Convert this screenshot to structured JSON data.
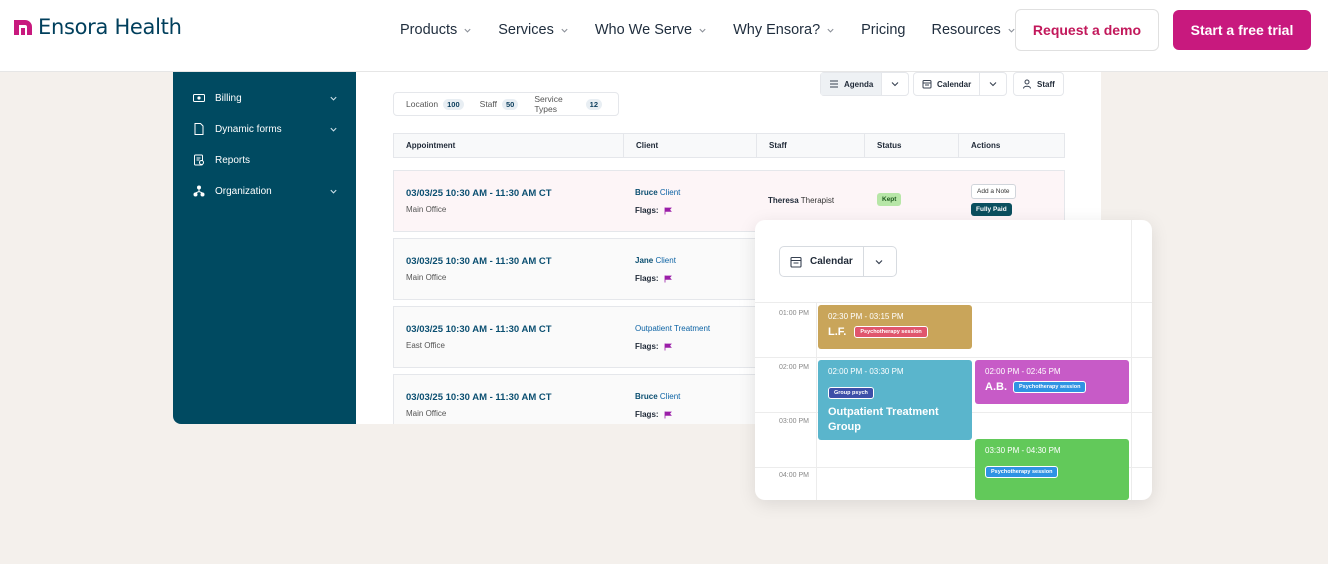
{
  "brand": {
    "name": "Ensora Health",
    "color": "#c8197e",
    "dark": "#003f5c"
  },
  "nav": {
    "items": [
      {
        "label": "Products",
        "dropdown": true
      },
      {
        "label": "Services",
        "dropdown": true
      },
      {
        "label": "Who We Serve",
        "dropdown": true
      },
      {
        "label": "Why Ensora?",
        "dropdown": true
      },
      {
        "label": "Pricing",
        "dropdown": false
      },
      {
        "label": "Resources",
        "dropdown": true
      }
    ],
    "demo_label": "Request a demo",
    "trial_label": "Start a free trial"
  },
  "sidebar": {
    "items": [
      {
        "label": "Billing",
        "icon": "billing-icon",
        "expandable": true
      },
      {
        "label": "Dynamic forms",
        "icon": "document-icon",
        "expandable": true
      },
      {
        "label": "Reports",
        "icon": "reports-icon",
        "expandable": false
      },
      {
        "label": "Organization",
        "icon": "organization-icon",
        "expandable": true
      }
    ]
  },
  "filters": [
    {
      "label": "Location",
      "count": "100"
    },
    {
      "label": "Staff",
      "count": "50"
    },
    {
      "label": "Service Types",
      "count": "12"
    }
  ],
  "views": {
    "agenda": "Agenda",
    "calendar": "Calendar",
    "staff": "Staff"
  },
  "table": {
    "headers": [
      "Appointment",
      "Client",
      "Staff",
      "Status",
      "Actions"
    ],
    "rows": [
      {
        "time": "03/03/25 10:30 AM - 11:30 AM CT",
        "location": "Main Office",
        "client_first": "Bruce",
        "client_rest": "Client",
        "flags": "Flags:",
        "staff_first": "Theresa",
        "staff_rest": "Therapist",
        "status": "Kept",
        "action1": "Add a Note",
        "action2": "Fully Paid"
      },
      {
        "time": "03/03/25 10:30 AM - 11:30 AM CT",
        "location": "Main Office",
        "client_first": "Jane",
        "client_rest": "Client",
        "flags": "Flags:"
      },
      {
        "time": "03/03/25 10:30 AM - 11:30 AM CT",
        "location": "East Office",
        "client_first": "",
        "client_rest": "Outpatient Treatment",
        "flags": "Flags:"
      },
      {
        "time": "03/03/25 10:30 AM - 11:30 AM CT",
        "location": "Main Office",
        "client_first": "Bruce",
        "client_rest": "Client",
        "flags": "Flags:"
      }
    ]
  },
  "calendar": {
    "view_label": "Calendar",
    "times": [
      "01:00 PM",
      "02:00 PM",
      "03:00 PM",
      "04:00 PM"
    ],
    "events": [
      {
        "time": "02:30 PM - 03:15 PM",
        "name": "L.F.",
        "tag": "Psychotherapy session",
        "color": "#c9a55a",
        "tag_color": "#e0566d"
      },
      {
        "time": "02:00 PM - 03:30 PM",
        "name": "Outpatient Treatment Group",
        "tag": "Group psych",
        "color": "#5ab5cc",
        "tag_color": "#3d4fa8"
      },
      {
        "time": "02:00 PM - 02:45 PM",
        "name": "A.B.",
        "tag": "Psychotherapy session",
        "color": "#c75bc7",
        "tag_color": "#2f93e3"
      },
      {
        "time": "03:30 PM - 04:30 PM",
        "name": "",
        "tag": "Psychotherapy session",
        "color": "#62c95a",
        "tag_color": "#2f93e3"
      }
    ]
  }
}
